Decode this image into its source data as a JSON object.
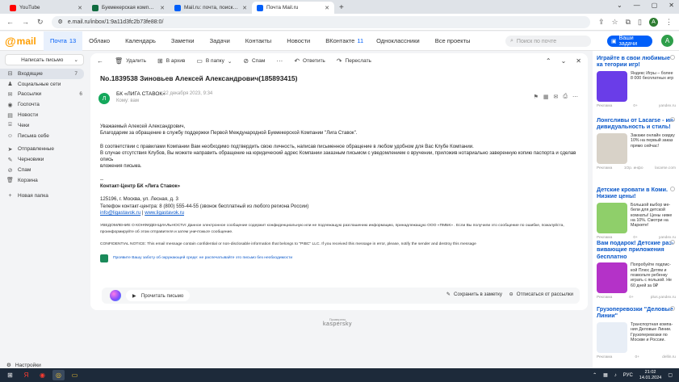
{
  "browser": {
    "tabs": [
      {
        "label": "YouTube",
        "color": "#ff0000",
        "active": false
      },
      {
        "label": "Букмекерская компания «Лига Ставок»",
        "color": "#0f6b3f",
        "active": false
      },
      {
        "label": "Mail.ru: почта, поиск, новости",
        "color": "#005ff9",
        "active": false
      },
      {
        "label": "Почта Mail.ru",
        "color": "#005ff9",
        "active": true
      }
    ],
    "url": "e.mail.ru/inbox/1:9a11d3fc2b73fe88:0/",
    "profile_initial": "A"
  },
  "mail_nav": {
    "logo": "mail",
    "items": [
      {
        "label": "Почта",
        "count": "13",
        "active": true
      },
      {
        "label": "Облако",
        "count": ""
      },
      {
        "label": "Календарь",
        "count": ""
      },
      {
        "label": "Заметки",
        "count": ""
      },
      {
        "label": "Задачи",
        "count": ""
      },
      {
        "label": "Контакты",
        "count": ""
      },
      {
        "label": "Новости",
        "count": ""
      },
      {
        "label": "ВКонтакте",
        "count": "11"
      },
      {
        "label": "Одноклассники",
        "count": ""
      },
      {
        "label": "Все проекты",
        "count": ""
      }
    ],
    "search_placeholder": "Поиск по почте",
    "tasks_button": "Ваши задачи",
    "avatar_initial": "A"
  },
  "sidebar": {
    "compose": "Написать письмо",
    "folders": [
      {
        "icon": "inbox-icon",
        "glyph": "⊟",
        "label": "Входящие",
        "count": "7",
        "active": true
      },
      {
        "icon": "social-icon",
        "glyph": "♟",
        "label": "Социальные сети",
        "count": ""
      },
      {
        "icon": "newsletter-icon",
        "glyph": "✉",
        "label": "Рассылки",
        "count": "6"
      },
      {
        "icon": "services-icon",
        "glyph": "◉",
        "label": "Госпочта",
        "count": ""
      },
      {
        "icon": "news-icon",
        "glyph": "▤",
        "label": "Новости",
        "count": ""
      },
      {
        "icon": "receipts-icon",
        "glyph": "⌸",
        "label": "Чеки",
        "count": ""
      },
      {
        "icon": "letter-to-self-icon",
        "glyph": "☺",
        "label": "Письма себе",
        "count": ""
      },
      {
        "icon": "sent-icon",
        "glyph": "➤",
        "label": "Отправленные",
        "count": ""
      },
      {
        "icon": "drafts-icon",
        "glyph": "✎",
        "label": "Черновики",
        "count": ""
      },
      {
        "icon": "spam-icon",
        "glyph": "⊘",
        "label": "Спам",
        "count": ""
      },
      {
        "icon": "trash-icon",
        "glyph": "🗑",
        "label": "Корзина",
        "count": ""
      },
      {
        "icon": "new-folder-icon",
        "glyph": "+",
        "label": "Новая папка",
        "count": ""
      }
    ],
    "settings": "Настройки"
  },
  "toolbar": {
    "back": "←",
    "delete": "Удалить",
    "archive": "В архив",
    "move": "В папку",
    "spam": "Спам",
    "reply": "Ответить",
    "forward": "Переслать"
  },
  "message": {
    "subject": "No.1839538 Зиновьев Алексей Александрович(185893415)",
    "sender_name": "БК «ЛИГА СТАВОК»",
    "sender_initial": "Л",
    "date": "22 декабря 2023, 9:34",
    "to": "Кому: вам",
    "greeting": "Уважаемый Алексей Александрович,",
    "line1": "Благодарим за обращение в службу поддержки Первой Международной Букмекерской Компании \"Лига Ставок\".",
    "para2a": "В соответствии с правилами Компании Вам необходимо подтвердить свою личность, написав письменное обращение в любом удобном для Вас Клубе Компании.",
    "para2b": "В случае отсутствия Клубов, Вы можете направить обращение на юридический адрес Компании заказным письмом с уведомлением о вручении, приложив нотариально заверенную копию паспорта и сделав опись",
    "para2c": "вложения письма.",
    "sig_dash": "--",
    "sig_title": "Контакт-Центр БК «Лига Ставок»",
    "address": "125196, г. Москва, ул. Лесная, д. 3",
    "phone": "Телефон контакт-центра: 8 (800) 555-44-55 (звонок бесплатный из любого региона России)",
    "email": "info@ligastavok.ru",
    "sep": " | ",
    "site": "www.ligastavok.ru",
    "notice_ru_a": "УВЕДОМЛЕНИЕ О КОНФИДЕНЦИАЛЬНОСТИ: Данное электронное сообщение содержит конфиденциальную или не подлежащую разглашению информацию, принадлежащую ООО «ПМБК» . Если Вы получили это сообщение по ошибке, пожалуйста,",
    "notice_ru_b": "проинформируйте об этом отправителя и затем уничтожьте сообщение.",
    "notice_en": "CONFIDENTIAL NOTICE: This email message contain confidential or non-disclosable information that belongs to \"PIBC\" LLC. If you received this message in error, please, notify the sender and destroy this message",
    "eco": "Проявите Вашу заботу об окружающей среде: не распечатывайте это письмо без необходимости"
  },
  "actions": {
    "read": "Прочитать письмо",
    "save": "Сохранить в заметку",
    "unsubscribe": "Отписаться от рассылки"
  },
  "antivirus": {
    "caption": "Проверено",
    "brand": "kaspersky"
  },
  "ads": [
    {
      "title": "Играйте в свои любимые ка тегории игр!",
      "text": "Яндекс Игры – более 8 000 бесплатных игр",
      "label": "Реклама",
      "age": "0+",
      "source": "yandex.ru",
      "color": "#6a3de8"
    },
    {
      "title": "Лонгсливы от Lacarse - ин- дивидуальность и стиль!",
      "text": "Закажи онлайн скидку 10% на первый заказ прямо сейчас!",
      "label": "Реклама",
      "age": "1Ор. инфо",
      "source": "lacarse.com",
      "color": "#d8d2c8"
    },
    {
      "title": "Детские кровати в Коми. Низкие цены!",
      "text": "Большой выбор ме- бели для детской комнаты! Цены ниже на 10%. Смотри на Маркете!",
      "label": "Реклама",
      "age": "0+",
      "source": "yandex.ru",
      "color": "#8fcf6a"
    },
    {
      "title": "Вам подарок! Детские раз- вивающие приложения бесплатно",
      "text": "Попробуйте подпис- кой Плюс Детям и позвольте ребенку играть с пользой. Не 60 дней за 0₽",
      "label": "Реклама",
      "age": "0+",
      "source": "plus.yandex.ru",
      "color": "#b432c8"
    },
    {
      "title": "Грузоперевозки \"Деловые Линии\"",
      "text": "Транспортная компа- ния Деловые Линии. Грузоперевозки по Москве и России.",
      "label": "Реклама",
      "age": "0+",
      "source": "dellin.ru",
      "color": "#e8eef6"
    }
  ],
  "taskbar": {
    "lang": "РУС",
    "time": "21:02",
    "date": "14.01.2024"
  }
}
